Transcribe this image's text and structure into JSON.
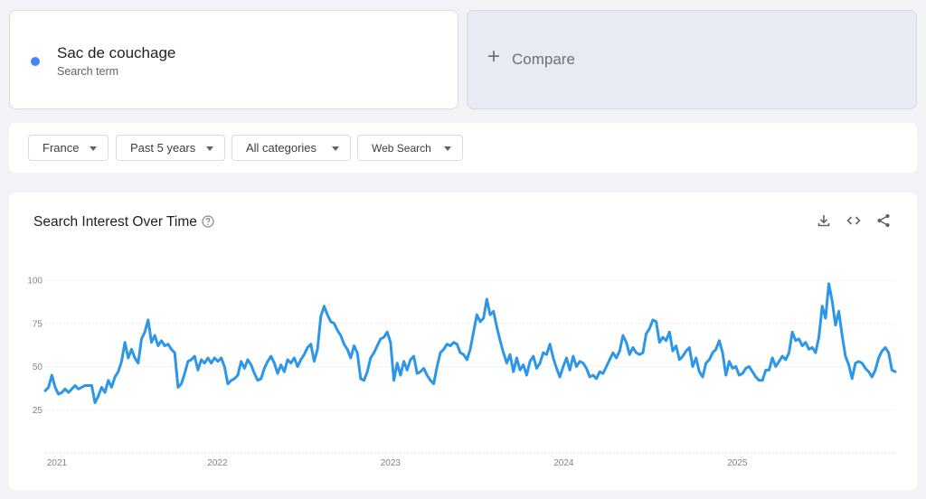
{
  "term": {
    "name": "Sac de couchage",
    "subtitle": "Search term",
    "color": "#4285f4"
  },
  "compare": {
    "label": "Compare",
    "icon": "plus-icon"
  },
  "filters": {
    "region": "France",
    "time": "Past 5 years",
    "category": "All categories",
    "search_type": "Web Search"
  },
  "chart_section": {
    "title": "Search Interest Over Time",
    "icons": [
      "help-icon",
      "download-icon",
      "embed-code-icon",
      "share-icon"
    ]
  },
  "chart_data": {
    "type": "line",
    "title": "Search Interest Over Time",
    "xlabel": "",
    "ylabel": "",
    "ylim": [
      0,
      100
    ],
    "yticks": [
      25,
      50,
      75,
      100
    ],
    "xticks": [
      "2021",
      "2022",
      "2023",
      "2024",
      "2025"
    ],
    "grid": true,
    "line_color": "#2d96e8",
    "series": [
      {
        "name": "Sac de couchage",
        "x_start": "2021-01-03",
        "interval": "weekly",
        "values": [
          36,
          38,
          45,
          38,
          34,
          35,
          37,
          35,
          37,
          39,
          37,
          38,
          39,
          39,
          39,
          29,
          33,
          38,
          35,
          42,
          38,
          44,
          47,
          53,
          64,
          55,
          60,
          55,
          52,
          66,
          70,
          77,
          64,
          68,
          62,
          65,
          62,
          63,
          60,
          58,
          38,
          40,
          46,
          53,
          54,
          56,
          48,
          54,
          52,
          55,
          52,
          55,
          53,
          55,
          50,
          40,
          42,
          43,
          45,
          53,
          49,
          54,
          51,
          46,
          42,
          43,
          49,
          53,
          56,
          52,
          46,
          51,
          47,
          54,
          52,
          55,
          50,
          54,
          57,
          61,
          63,
          53,
          60,
          79,
          85,
          80,
          76,
          75,
          71,
          68,
          63,
          60,
          55,
          62,
          58,
          43,
          42,
          47,
          55,
          58,
          62,
          66,
          67,
          70,
          64,
          42,
          52,
          45,
          53,
          48,
          54,
          56,
          46,
          47,
          49,
          45,
          42,
          40,
          50,
          58,
          60,
          63,
          62,
          64,
          63,
          58,
          57,
          54,
          60,
          70,
          80,
          76,
          78,
          89,
          80,
          82,
          73,
          65,
          58,
          52,
          57,
          47,
          55,
          48,
          51,
          45,
          53,
          56,
          49,
          52,
          58,
          57,
          63,
          55,
          49,
          44,
          50,
          55,
          48,
          56,
          50,
          53,
          52,
          49,
          44,
          45,
          43,
          47,
          46,
          50,
          54,
          58,
          55,
          59,
          68,
          64,
          57,
          61,
          58,
          57,
          58,
          69,
          72,
          77,
          76,
          64,
          67,
          65,
          70,
          59,
          62,
          54,
          56,
          59,
          61,
          50,
          55,
          47,
          44,
          52,
          54,
          58,
          60,
          65,
          58,
          45,
          53,
          49,
          50,
          45,
          46,
          49,
          50,
          47,
          44,
          42,
          42,
          48,
          48,
          55,
          50,
          53,
          56,
          54,
          58,
          70,
          65,
          66,
          62,
          64,
          60,
          61,
          58,
          67,
          85,
          78,
          98,
          88,
          74,
          82,
          68,
          56,
          51,
          43,
          52,
          53,
          52,
          49,
          47,
          44,
          48,
          55,
          59,
          61,
          58,
          48,
          47
        ]
      }
    ]
  }
}
